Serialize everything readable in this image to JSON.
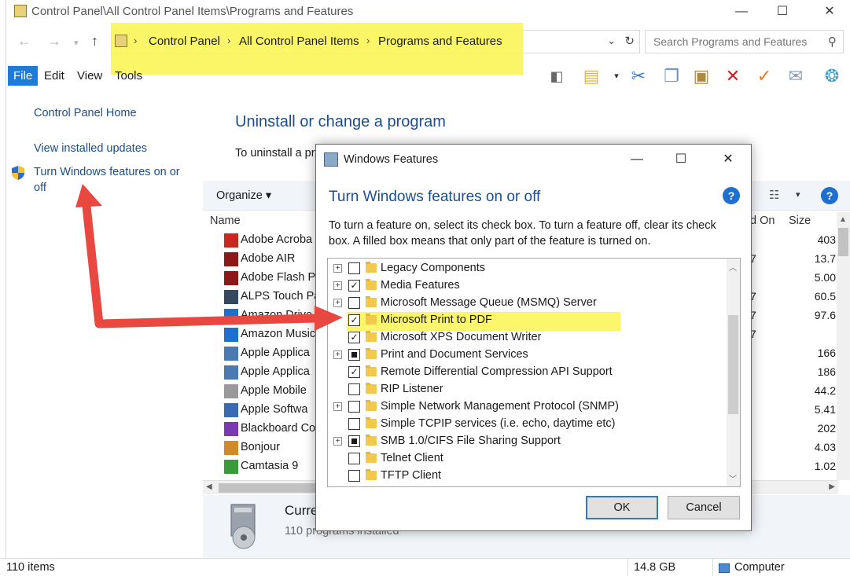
{
  "window": {
    "title": "Control Panel\\All Control Panel Items\\Programs and Features",
    "controls": {
      "minimize": "—",
      "maximize": "☐",
      "close": "✕"
    }
  },
  "address": {
    "crumbs": [
      "Control Panel",
      "All Control Panel Items",
      "Programs and Features"
    ],
    "search_placeholder": "Search Programs and Features"
  },
  "menubar": {
    "items": [
      "File",
      "Edit",
      "View",
      "Tools"
    ]
  },
  "toolbar_icons": [
    "panel-icon",
    "notes-icon",
    "cut-icon",
    "copy-icon",
    "paste-icon",
    "delete-icon",
    "check-icon",
    "mail-icon",
    "shell-icon"
  ],
  "nav": {
    "home": "Control Panel Home",
    "updates": "View installed updates",
    "features_line1": "Turn Windows features on or",
    "features_line2": "off"
  },
  "main": {
    "title": "Uninstall or change a program",
    "desc": "To uninstall a pr",
    "organize": "Organize ▾",
    "columns": {
      "name": "Name",
      "installed_on": "d On",
      "size": "Size"
    },
    "programs": [
      {
        "name": "Adobe Acroba",
        "date": "",
        "size": "403"
      },
      {
        "name": "Adobe AIR",
        "date": "7",
        "size": "13.7"
      },
      {
        "name": "Adobe Flash P",
        "date": "",
        "size": "5.00"
      },
      {
        "name": "ALPS Touch Pa",
        "date": "7",
        "size": "60.5"
      },
      {
        "name": "Amazon Drive",
        "date": "7",
        "size": "97.6"
      },
      {
        "name": "Amazon Music",
        "date": "7",
        "size": ""
      },
      {
        "name": "Apple Applica",
        "date": "",
        "size": "166"
      },
      {
        "name": "Apple Applica",
        "date": "",
        "size": "186"
      },
      {
        "name": "Apple Mobile",
        "date": "",
        "size": "44.2"
      },
      {
        "name": "Apple Softwa",
        "date": "",
        "size": "5.41"
      },
      {
        "name": "Blackboard Co",
        "date": "",
        "size": "202"
      },
      {
        "name": "Bonjour",
        "date": "",
        "size": "4.03"
      },
      {
        "name": "Camtasia 9",
        "date": "",
        "size": "1.02"
      }
    ],
    "details_title": "Curre",
    "details_count": "110 programs installed"
  },
  "statusbar": {
    "items": "110 items",
    "size": "14.8 GB",
    "location": "Computer"
  },
  "dialog": {
    "title": "Windows Features",
    "heading": "Turn Windows features on or off",
    "help": "?",
    "desc": "To turn a feature on, select its check box. To turn a feature off, clear its check box. A filled box means that only part of the feature is turned on.",
    "features": [
      {
        "label": "Legacy Components",
        "expandable": true,
        "state": "off"
      },
      {
        "label": "Media Features",
        "expandable": true,
        "state": "on"
      },
      {
        "label": "Microsoft Message Queue (MSMQ) Server",
        "expandable": true,
        "state": "off"
      },
      {
        "label": "Microsoft Print to PDF",
        "expandable": false,
        "state": "on"
      },
      {
        "label": "Microsoft XPS Document Writer",
        "expandable": false,
        "state": "on"
      },
      {
        "label": "Print and Document Services",
        "expandable": true,
        "state": "partial"
      },
      {
        "label": "Remote Differential Compression API Support",
        "expandable": false,
        "state": "on"
      },
      {
        "label": "RIP Listener",
        "expandable": false,
        "state": "off"
      },
      {
        "label": "Simple Network Management Protocol (SNMP)",
        "expandable": true,
        "state": "off"
      },
      {
        "label": "Simple TCPIP services (i.e. echo, daytime etc)",
        "expandable": false,
        "state": "off"
      },
      {
        "label": "SMB 1.0/CIFS File Sharing Support",
        "expandable": true,
        "state": "partial"
      },
      {
        "label": "Telnet Client",
        "expandable": false,
        "state": "off"
      },
      {
        "label": "TFTP Client",
        "expandable": false,
        "state": "off"
      }
    ],
    "ok": "OK",
    "cancel": "Cancel"
  },
  "colors": {
    "highlight": "#fbf55a",
    "arrow": "#e8483f",
    "link": "#1a4e8a",
    "heading": "#1c4e8c",
    "accent": "#2e78c7"
  }
}
